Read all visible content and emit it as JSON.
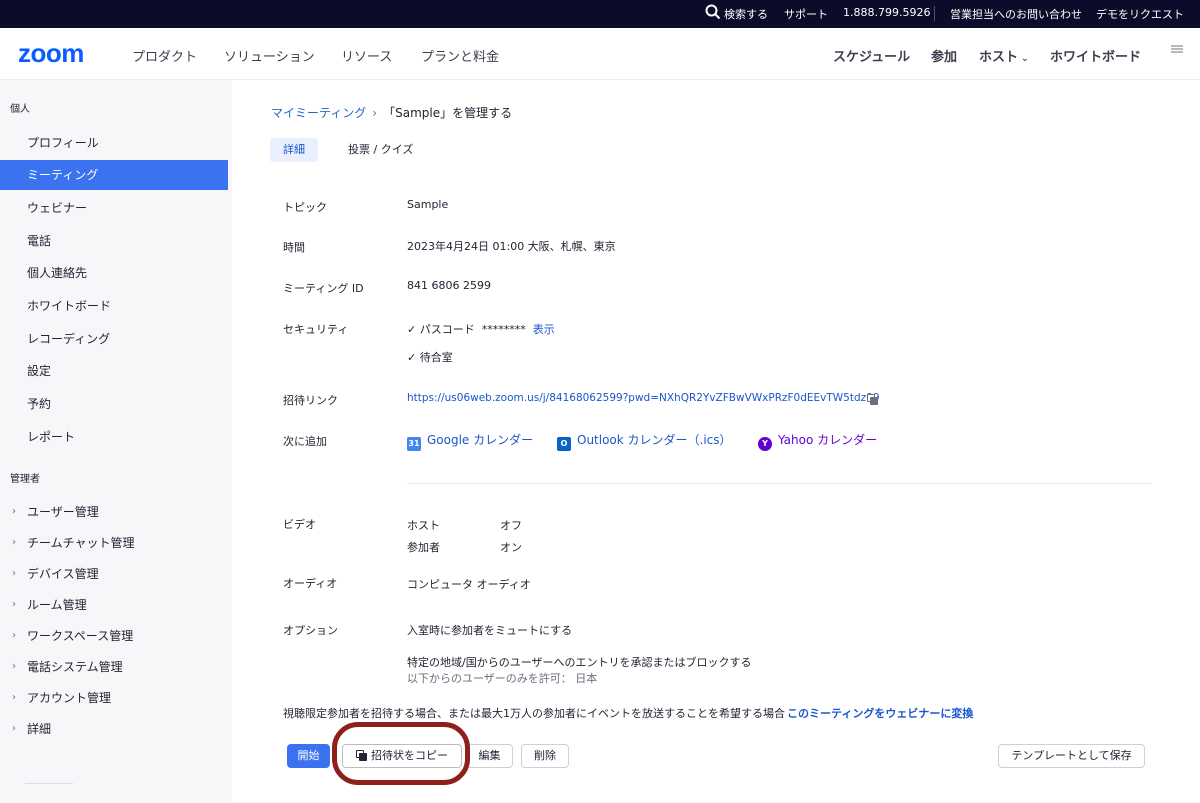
{
  "topbar": {
    "search_label": "検索する",
    "support": "サポート",
    "phone": "1.888.799.5926",
    "contact_sales": "営業担当へのお問い合わせ",
    "request_demo": "デモをリクエスト"
  },
  "nav": {
    "logo": "zoom",
    "products": "プロダクト",
    "solutions": "ソリューション",
    "resources": "リソース",
    "plans": "プランと料金",
    "schedule": "スケジュール",
    "join": "参加",
    "host": "ホスト",
    "whiteboard": "ホワイトボード"
  },
  "sidebar": {
    "personal_header": "個人",
    "items": [
      {
        "label": "プロフィール"
      },
      {
        "label": "ミーティング"
      },
      {
        "label": "ウェビナー"
      },
      {
        "label": "電話"
      },
      {
        "label": "個人連絡先"
      },
      {
        "label": "ホワイトボード"
      },
      {
        "label": "レコーディング"
      },
      {
        "label": "設定"
      },
      {
        "label": "予約"
      },
      {
        "label": "レポート"
      }
    ],
    "admin_header": "管理者",
    "admin_items": [
      {
        "label": "ユーザー管理"
      },
      {
        "label": "チームチャット管理"
      },
      {
        "label": "デバイス管理"
      },
      {
        "label": "ルーム管理"
      },
      {
        "label": "ワークスペース管理"
      },
      {
        "label": "電話システム管理"
      },
      {
        "label": "アカウント管理"
      },
      {
        "label": "詳細"
      }
    ]
  },
  "breadcrumb": {
    "parent": "マイミーティング",
    "separator": "›",
    "current": "「Sample」を管理する"
  },
  "tabs": {
    "detail": "詳細",
    "polls": "投票 / クイズ"
  },
  "meeting": {
    "topic_label": "トピック",
    "topic": "Sample",
    "time_label": "時間",
    "time": "2023年4月24日 01:00 大阪、札幌、東京",
    "id_label": "ミーティング ID",
    "id": "841 6806 2599",
    "security_label": "セキュリティ",
    "passcode_label": "✓  パスコード",
    "passcode_mask": "********",
    "show_link": "表示",
    "waiting_room": "✓  待合室",
    "invite_label": "招待リンク",
    "invite_url": "https://us06web.zoom.us/j/84168062599?pwd=NXhQR2YvZFBwVWxPRzF0dEEvTW5tdz09",
    "add_to_label": "次に追加",
    "google_cal": "Google カレンダー",
    "outlook_cal": "Outlook カレンダー（.ics）",
    "yahoo_cal": "Yahoo カレンダー",
    "video_label": "ビデオ",
    "video_host": "ホスト",
    "video_host_val": "オフ",
    "video_participant": "参加者",
    "video_participant_val": "オン",
    "audio_label": "オーディオ",
    "audio": "コンピュータ オーディオ",
    "options_label": "オプション",
    "option1": "入室時に参加者をミュートにする",
    "option2": "特定の地域/国からのユーザーへのエントリを承認またはブロックする",
    "option2_sub": "以下からのユーザーのみを許可： 日本",
    "webinar_note": "視聴限定参加者を招待する場合、または最大1万人の参加者にイベントを放送することを希望する場合",
    "webinar_convert": "このミーティングをウェビナーに変換"
  },
  "actions": {
    "start": "開始",
    "copy_invite": "招待状をコピー",
    "edit": "編集",
    "delete": "削除",
    "save_template": "テンプレートとして保存"
  },
  "colors": {
    "brand": "#0b5cff",
    "active": "#3a72ef",
    "link": "#1a56cc",
    "highlight_ring": "#8e1f1a"
  }
}
